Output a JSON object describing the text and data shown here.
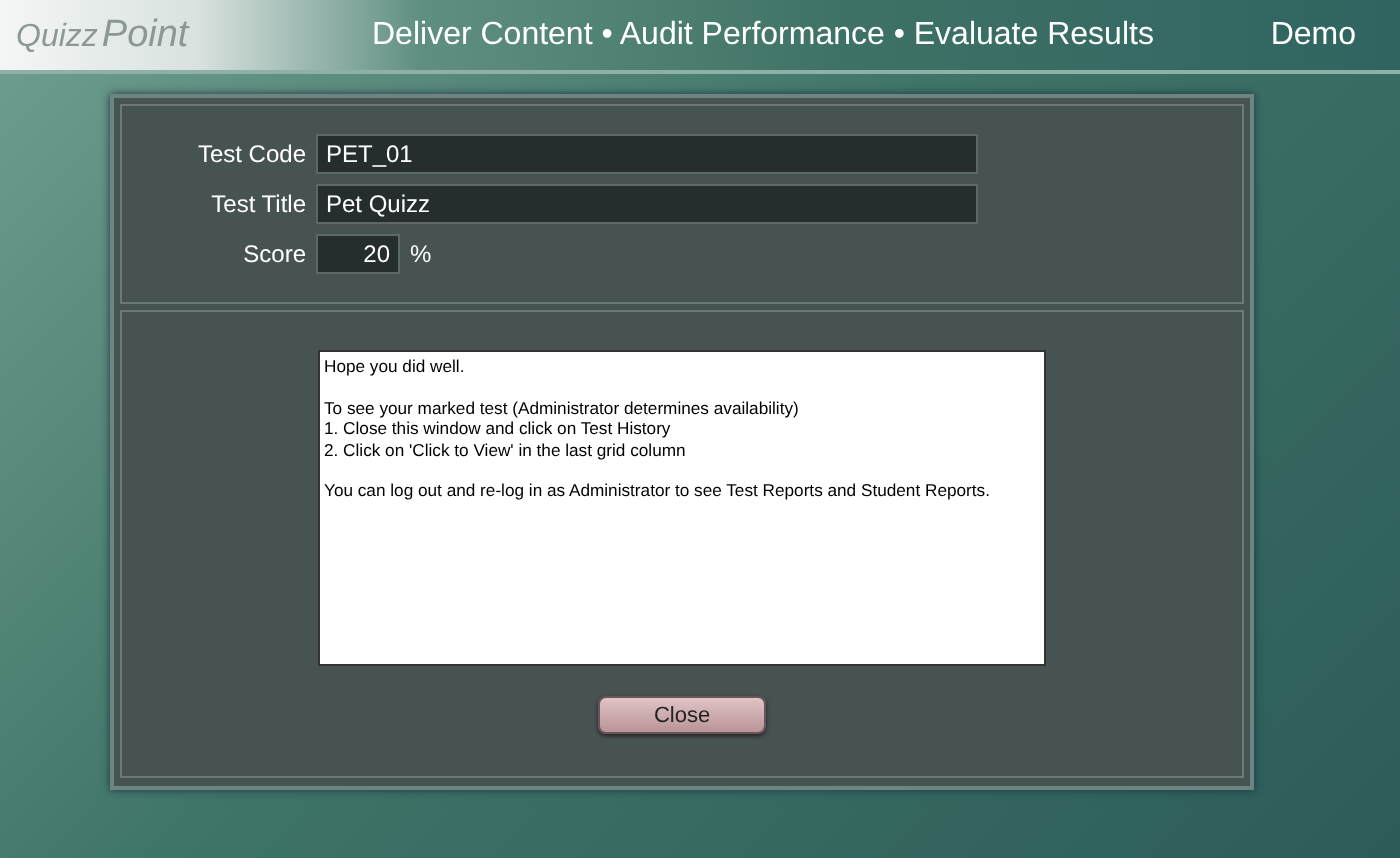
{
  "header": {
    "logo": [
      "Quizz",
      "Point"
    ],
    "tagline": "Deliver Content • Audit Performance • Evaluate Results",
    "user": "Demo"
  },
  "fields": [
    {
      "label": "Test Code",
      "value": "PET_01",
      "kind": "wide"
    },
    {
      "label": "Test Title",
      "value": "Pet Quizz",
      "kind": "wide"
    },
    {
      "label": "Score",
      "value": "20",
      "kind": "short",
      "suffix": "%"
    }
  ],
  "message": [
    "Hope you did well.",
    "To see your marked test (Administrator determines availability)\n1. Close this window and click on Test History\n2. Click on 'Click to View' in the last grid column",
    "You can log out and re-log in as Administrator to see Test Reports and Student Reports."
  ],
  "buttons": [
    "Close"
  ]
}
